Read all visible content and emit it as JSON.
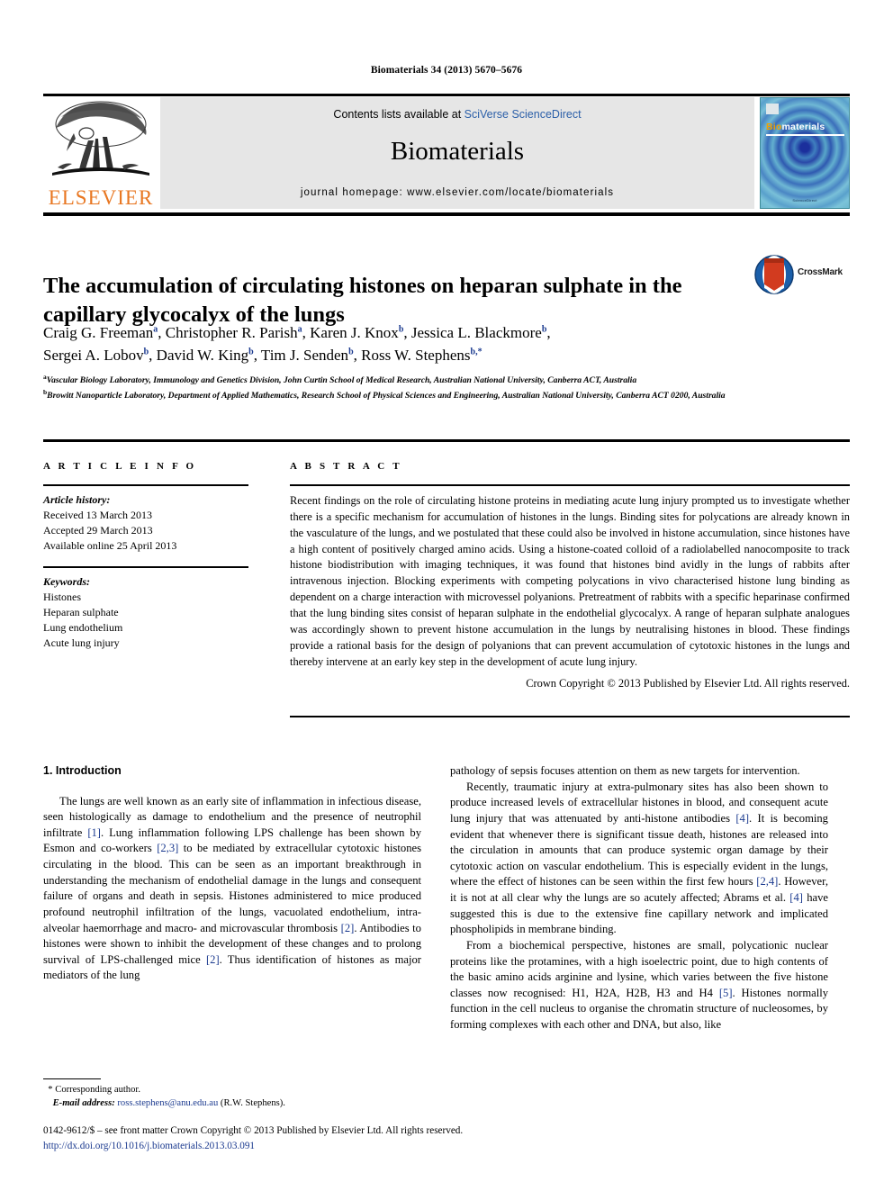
{
  "running_head": "Biomaterials 34 (2013) 5670–5676",
  "masthead": {
    "publisher_name": "ELSEVIER",
    "contents_prefix": "Contents lists available at ",
    "contents_link": "SciVerse ScienceDirect",
    "journal_name": "Biomaterials",
    "homepage": "journal homepage: www.elsevier.com/locate/biomaterials",
    "cover": {
      "title_part1": "Bio",
      "title_part2": "materials",
      "footer_text": "ScienceDirect"
    }
  },
  "article": {
    "title": "The accumulation of circulating histones on heparan sulphate in the capillary glycocalyx of the lungs",
    "crossmark_label": "CrossMark",
    "authors_line1": "Craig G. Freeman a, Christopher R. Parish a, Karen J. Knox b, Jessica L. Blackmore b,",
    "authors_line2": "Sergei A. Lobov b, David W. King b, Tim J. Senden b, Ross W. Stephens b,*",
    "affiliation_a": "Vascular Biology Laboratory, Immunology and Genetics Division, John Curtin School of Medical Research, Australian National University, Canberra ACT, Australia",
    "affiliation_b": "Browitt Nanoparticle Laboratory, Department of Applied Mathematics, Research School of Physical Sciences and Engineering, Australian National University, Canberra ACT 0200, Australia"
  },
  "info": {
    "heading": "A R T I C L E   I N F O",
    "history_label": "Article history:",
    "history": [
      "Received 13 March 2013",
      "Accepted 29 March 2013",
      "Available online 25 April 2013"
    ],
    "keywords_label": "Keywords:",
    "keywords": [
      "Histones",
      "Heparan sulphate",
      "Lung endothelium",
      "Acute lung injury"
    ]
  },
  "abstract": {
    "heading": "A B S T R A C T",
    "text": "Recent findings on the role of circulating histone proteins in mediating acute lung injury prompted us to investigate whether there is a specific mechanism for accumulation of histones in the lungs. Binding sites for polycations are already known in the vasculature of the lungs, and we postulated that these could also be involved in histone accumulation, since histones have a high content of positively charged amino acids. Using a histone-coated colloid of a radiolabelled nanocomposite to track histone biodistribution with imaging techniques, it was found that histones bind avidly in the lungs of rabbits after intravenous injection. Blocking experiments with competing polycations in vivo characterised histone lung binding as dependent on a charge interaction with microvessel polyanions. Pretreatment of rabbits with a specific heparinase confirmed that the lung binding sites consist of heparan sulphate in the endothelial glycocalyx. A range of heparan sulphate analogues was accordingly shown to prevent histone accumulation in the lungs by neutralising histones in blood. These findings provide a rational basis for the design of polyanions that can prevent accumulation of cytotoxic histones in the lungs and thereby intervene at an early key step in the development of acute lung injury.",
    "copyright": "Crown Copyright © 2013 Published by Elsevier Ltd. All rights reserved."
  },
  "body": {
    "section_heading": "1. Introduction",
    "left_paragraphs": [
      "The lungs are well known as an early site of inflammation in infectious disease, seen histologically as damage to endothelium and the presence of neutrophil infiltrate [1]. Lung inflammation following LPS challenge has been shown by Esmon and co-workers [2,3] to be mediated by extracellular cytotoxic histones circulating in the blood. This can be seen as an important breakthrough in understanding the mechanism of endothelial damage in the lungs and consequent failure of organs and death in sepsis. Histones administered to mice produced profound neutrophil infiltration of the lungs, vacuolated endothelium, intra-alveolar haemorrhage and macro- and microvascular thrombosis [2]. Antibodies to histones were shown to inhibit the development of these changes and to prolong survival of LPS-challenged mice [2]. Thus identification of histones as major mediators of the lung"
    ],
    "right_paragraphs": [
      "pathology of sepsis focuses attention on them as new targets for intervention.",
      "Recently, traumatic injury at extra-pulmonary sites has also been shown to produce increased levels of extracellular histones in blood, and consequent acute lung injury that was attenuated by anti-histone antibodies [4]. It is becoming evident that whenever there is significant tissue death, histones are released into the circulation in amounts that can produce systemic organ damage by their cytotoxic action on vascular endothelium. This is especially evident in the lungs, where the effect of histones can be seen within the first few hours [2,4]. However, it is not at all clear why the lungs are so acutely affected; Abrams et al. [4] have suggested this is due to the extensive fine capillary network and implicated phospholipids in membrane binding.",
      "From a biochemical perspective, histones are small, polycationic nuclear proteins like the protamines, with a high isoelectric point, due to high contents of the basic amino acids arginine and lysine, which varies between the five histone classes now recognised: H1, H2A, H2B, H3 and H4 [5]. Histones normally function in the cell nucleus to organise the chromatin structure of nucleosomes, by forming complexes with each other and DNA, but also, like"
    ]
  },
  "footnote": {
    "corresponding_marker": "*",
    "corresponding_text": "Corresponding author.",
    "email_label": "E-mail address:",
    "email": "ross.stephens@anu.edu.au",
    "email_owner": "(R.W. Stephens)."
  },
  "footer": {
    "issn_line": "0142-9612/$ – see front matter Crown Copyright © 2013 Published by Elsevier Ltd. All rights reserved.",
    "doi": "http://dx.doi.org/10.1016/j.biomaterials.2013.03.091"
  },
  "colors": {
    "link_blue": "#1b3a8f",
    "sciencedirect_blue": "#2b5fa8",
    "elsevier_orange": "#E87722",
    "band_gray": "#e6e6e6"
  }
}
